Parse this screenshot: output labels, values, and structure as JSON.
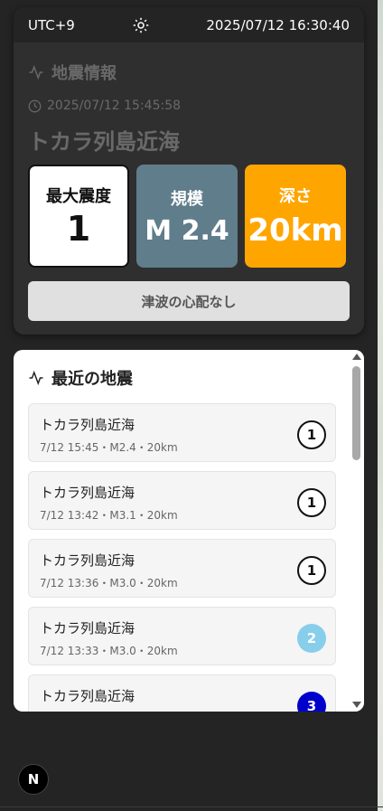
{
  "header": {
    "timezone": "UTC+9",
    "datetime": "2025/07/12 16:30:40",
    "theme_icon": "sun-icon"
  },
  "info": {
    "title": "地震情報",
    "time": "2025/07/12 15:45:58",
    "place": "トカラ列島近海",
    "cards": {
      "intensity_label": "最大震度",
      "intensity_value": "1",
      "magnitude_label": "規模",
      "magnitude_value": "M 2.4",
      "depth_label": "深さ",
      "depth_value": "20km"
    },
    "tsunami": "津波の心配なし"
  },
  "recent": {
    "title": "最近の地震",
    "items": [
      {
        "place": "トカラ列島近海",
        "meta": "7/12 15:45・M2.4・20km",
        "intensity": "1"
      },
      {
        "place": "トカラ列島近海",
        "meta": "7/12 13:42・M3.1・20km",
        "intensity": "1"
      },
      {
        "place": "トカラ列島近海",
        "meta": "7/12 13:36・M3.0・20km",
        "intensity": "1"
      },
      {
        "place": "トカラ列島近海",
        "meta": "7/12 13:33・M3.0・20km",
        "intensity": "2"
      },
      {
        "place": "トカラ列島近海",
        "meta": "",
        "intensity": "3"
      }
    ]
  },
  "colors": {
    "intensity_1": "#ffffff",
    "intensity_2": "#87ceeb",
    "intensity_3": "#0000cd",
    "magnitude_card": "#607d8b",
    "depth_card": "#ffa500"
  },
  "floating_button": "N"
}
